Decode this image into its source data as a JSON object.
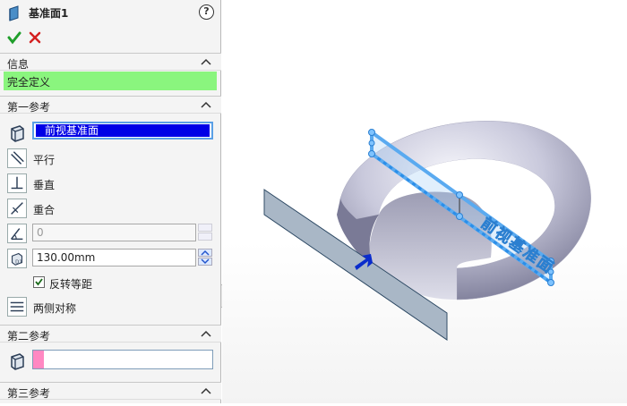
{
  "feature": {
    "title": "基准面1",
    "help_glyph": "?"
  },
  "info": {
    "header": "信息",
    "status": "完全定义",
    "status_color": "#8af57e"
  },
  "first_ref": {
    "header": "第一参考",
    "selection": "前视基准面",
    "options": {
      "parallel": "平行",
      "perpendicular": "垂直",
      "coincident": "重合"
    },
    "angle_value": "0",
    "offset_value": "130.00mm",
    "flip_label": "反转等距",
    "flip_checked": true,
    "mid_plane_label": "两侧对称"
  },
  "second_ref": {
    "header": "第二参考",
    "selection_color": "#ff88c2"
  },
  "third_ref": {
    "header": "第三参考"
  },
  "viewport": {
    "plane_label": "前视基准面"
  },
  "colors": {
    "accent_blue": "#0000e6",
    "preview_plane": "#5aaaf0"
  }
}
